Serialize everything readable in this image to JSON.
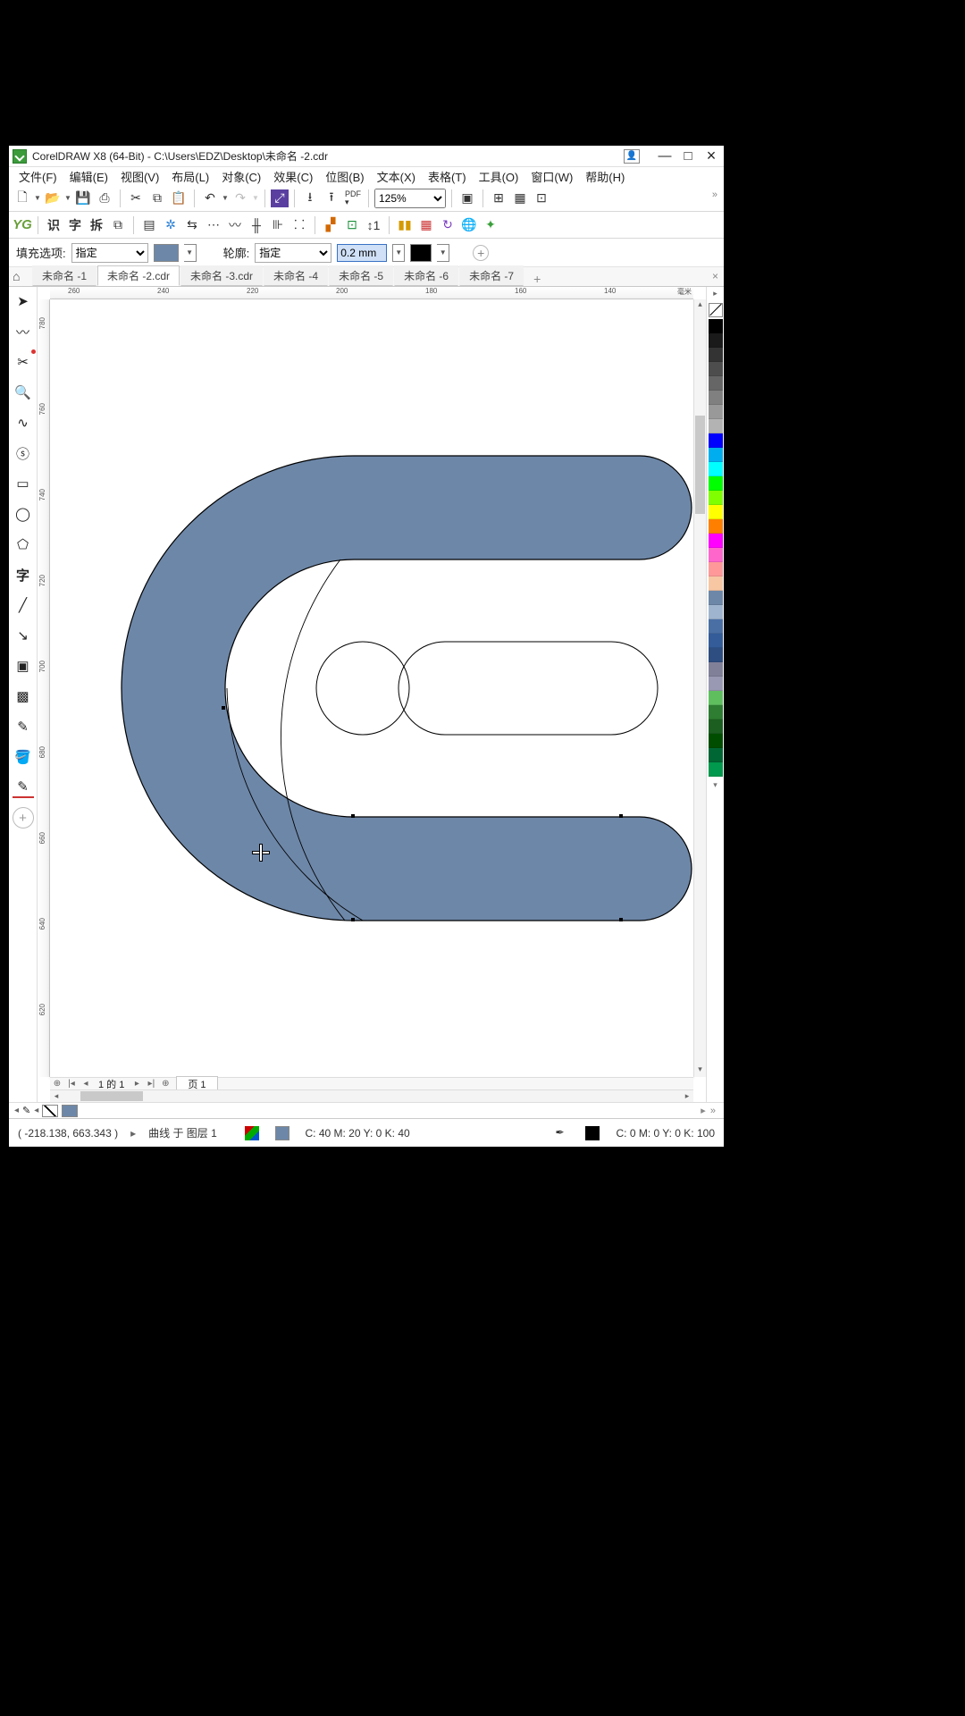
{
  "title": "CorelDRAW X8 (64-Bit) - C:\\Users\\EDZ\\Desktop\\未命名 -2.cdr",
  "menu": [
    "文件(F)",
    "编辑(E)",
    "视图(V)",
    "布局(L)",
    "对象(C)",
    "效果(C)",
    "位图(B)",
    "文本(X)",
    "表格(T)",
    "工具(O)",
    "窗口(W)",
    "帮助(H)"
  ],
  "zoom": "125%",
  "tb3": {
    "fill_label": "填充选项:",
    "fill_mode": "指定",
    "outline_label": "轮廓:",
    "outline_mode": "指定",
    "outline_width": "0.2 mm"
  },
  "doc_tabs": [
    "未命名 -1",
    "未命名 -2.cdr",
    "未命名 -3.cdr",
    "未命名 -4",
    "未命名 -5",
    "未命名 -6",
    "未命名 -7"
  ],
  "doc_active": 1,
  "ruler_h": [
    "260",
    "240",
    "220",
    "200",
    "180",
    "160",
    "140"
  ],
  "ruler_h_unit": "毫米",
  "ruler_v": [
    "780",
    "760",
    "740",
    "720",
    "700",
    "680",
    "660",
    "640",
    "620"
  ],
  "pagebar": {
    "counter": "1 的 1",
    "page_label": "页 1"
  },
  "status": {
    "coords": "( -218.138, 663.343 )",
    "object": "曲线 于 图层 1",
    "fill_cmyk": "C: 40 M: 20 Y: 0 K: 40",
    "outline_cmyk": "C: 0 M: 0 Y: 0 K: 100"
  },
  "palette": [
    "#000000",
    "#1a1a1a",
    "#333333",
    "#4d4d4d",
    "#666666",
    "#808080",
    "#999999",
    "#b3b3b3",
    "#0000ff",
    "#00aeef",
    "#00ffff",
    "#00ff00",
    "#7fff00",
    "#ffff00",
    "#ff7f00",
    "#ff00ff",
    "#ff66cc",
    "#ff9999",
    "#f7c6a3",
    "#6d87a8",
    "#9fb4ce",
    "#4a6fa5",
    "#335c99",
    "#2e4d80",
    "#808099",
    "#9999b3",
    "#5fbf5f",
    "#2e7d32",
    "#1b5e20",
    "#004d00",
    "#006633",
    "#00994d"
  ],
  "shape_fill": "#6d87a8",
  "outline_color": "#000000"
}
